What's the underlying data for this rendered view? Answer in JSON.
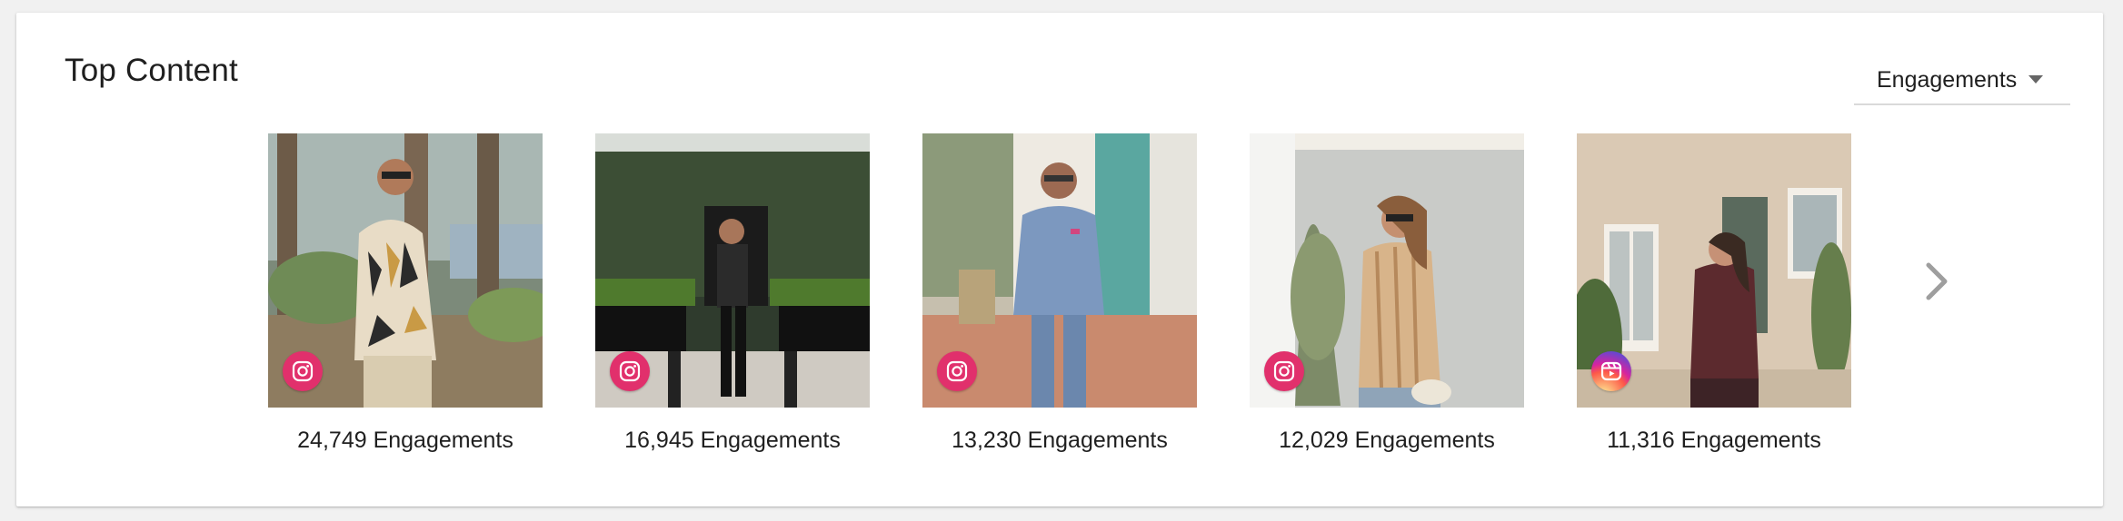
{
  "card": {
    "title": "Top Content",
    "sort_dropdown": {
      "selected": "Engagements"
    }
  },
  "items": [
    {
      "engagements_label": "24,749 Engagements",
      "platform_icon": "instagram-icon"
    },
    {
      "engagements_label": "16,945 Engagements",
      "platform_icon": "instagram-icon"
    },
    {
      "engagements_label": "13,230 Engagements",
      "platform_icon": "instagram-icon"
    },
    {
      "engagements_label": "12,029 Engagements",
      "platform_icon": "instagram-icon"
    },
    {
      "engagements_label": "11,316 Engagements",
      "platform_icon": "instagram-reels-icon"
    }
  ],
  "colors": {
    "instagram_badge": "#e1306c",
    "text": "#1f1f1f",
    "chevron": "#9e9e9e"
  }
}
